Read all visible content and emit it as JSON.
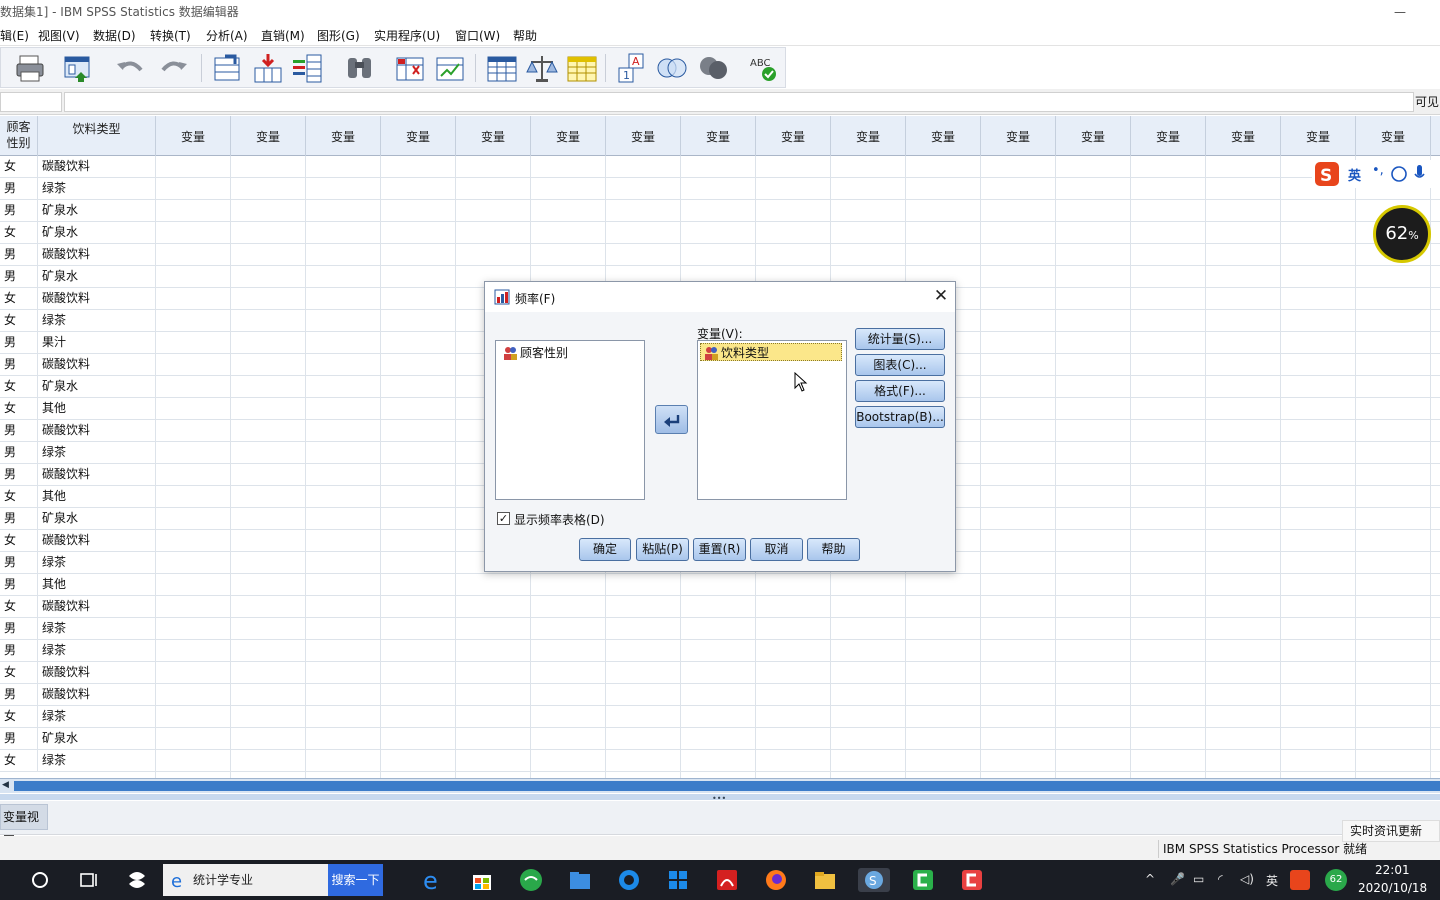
{
  "window": {
    "title": "数据集1] - IBM SPSS Statistics 数据编辑器",
    "minimize": "—"
  },
  "menu": [
    "辑(E)",
    "视图(V)",
    "数据(D)",
    "转换(T)",
    "分析(A)",
    "直销(M)",
    "图形(G)",
    "实用程序(U)",
    "窗口(W)",
    "帮助"
  ],
  "toolbar_icons": [
    "print-icon",
    "recall-dialog-icon",
    "undo-icon",
    "redo-icon",
    "goto-case-icon",
    "goto-variable-icon",
    "variables-icon",
    "find-icon",
    "insert-cases-icon",
    "insert-variable-icon",
    "split-file-icon",
    "weight-cases-icon",
    "select-cases-icon",
    "value-labels-icon",
    "use-sets-icon",
    "show-all-variables-icon",
    "spell-check-icon"
  ],
  "editrow": {
    "visible_label": "可见"
  },
  "grid": {
    "headers": [
      "顾客\n性别",
      "饮料类型",
      "变量",
      "变量",
      "变量",
      "变量",
      "变量",
      "变量",
      "变量",
      "变量",
      "变量",
      "变量",
      "变量",
      "变量",
      "变量",
      "变量",
      "变量",
      "变量",
      "变量"
    ],
    "rows": [
      [
        "女",
        "碳酸饮料"
      ],
      [
        "男",
        "绿茶"
      ],
      [
        "男",
        "矿泉水"
      ],
      [
        "女",
        "矿泉水"
      ],
      [
        "男",
        "碳酸饮料"
      ],
      [
        "男",
        "矿泉水"
      ],
      [
        "女",
        "碳酸饮料"
      ],
      [
        "女",
        "绿茶"
      ],
      [
        "男",
        "果汁"
      ],
      [
        "男",
        "碳酸饮料"
      ],
      [
        "女",
        "矿泉水"
      ],
      [
        "女",
        "其他"
      ],
      [
        "男",
        "碳酸饮料"
      ],
      [
        "男",
        "绿茶"
      ],
      [
        "男",
        "碳酸饮料"
      ],
      [
        "女",
        "其他"
      ],
      [
        "男",
        "矿泉水"
      ],
      [
        "女",
        "碳酸饮料"
      ],
      [
        "男",
        "绿茶"
      ],
      [
        "男",
        "其他"
      ],
      [
        "女",
        "碳酸饮料"
      ],
      [
        "男",
        "绿茶"
      ],
      [
        "男",
        "绿茶"
      ],
      [
        "女",
        "碳酸饮料"
      ],
      [
        "男",
        "碳酸饮料"
      ],
      [
        "女",
        "绿茶"
      ],
      [
        "男",
        "矿泉水"
      ],
      [
        "女",
        "绿茶"
      ]
    ]
  },
  "view_tabs": {
    "variable_view": "变量视图"
  },
  "status": {
    "processor": "IBM SPSS Statistics Processor 就绪",
    "news": "实时资讯更新"
  },
  "overlay": {
    "cpu_value": "62",
    "cpu_unit": "%",
    "ime_lang": "英"
  },
  "dialog": {
    "title": "频率(F)",
    "close": "✕",
    "variables_label": "变量(V):",
    "source_items": [
      "顾客性别"
    ],
    "target_items": [
      "饮料类型"
    ],
    "side_buttons": [
      "统计量(S)...",
      "图表(C)...",
      "格式(F)...",
      "Bootstrap(B)..."
    ],
    "checkbox_label": "显示频率表格(D)",
    "checkbox_checked": true,
    "bottom_buttons": [
      "确定",
      "粘贴(P)",
      "重置(R)",
      "取消",
      "帮助"
    ]
  },
  "taskbar": {
    "search_text": "统计学专业",
    "search_button": "搜索一下",
    "tray_lang": "英",
    "tray_badge": "62",
    "time": "22:01",
    "date": "2020/10/18"
  },
  "colors": {
    "accent": "#2f6ae0",
    "grid_header": "#e7eef8",
    "selected_item": "#fbe78a"
  }
}
